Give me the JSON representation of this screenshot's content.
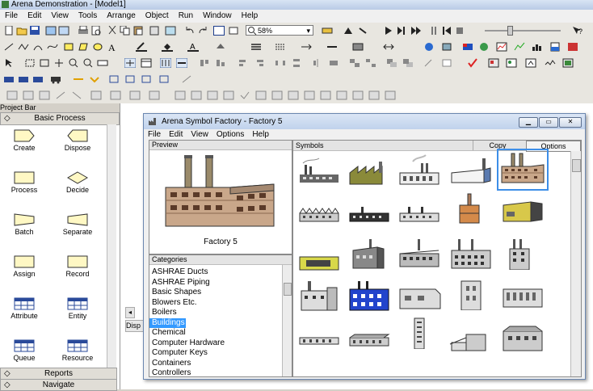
{
  "window": {
    "title": "Arena Demonstration - [Model1]"
  },
  "menubar": [
    "File",
    "Edit",
    "View",
    "Tools",
    "Arrange",
    "Object",
    "Run",
    "Window",
    "Help"
  ],
  "toolbar": {
    "zoom_value": "58%"
  },
  "project_bar": {
    "title": "Project Bar",
    "panel": "Basic Process",
    "modules": [
      {
        "label": "Create",
        "shape": "create"
      },
      {
        "label": "Dispose",
        "shape": "dispose"
      },
      {
        "label": "Process",
        "shape": "rect"
      },
      {
        "label": "Decide",
        "shape": "diamond"
      },
      {
        "label": "Batch",
        "shape": "batch"
      },
      {
        "label": "Separate",
        "shape": "separate"
      },
      {
        "label": "Assign",
        "shape": "rect"
      },
      {
        "label": "Record",
        "shape": "rect"
      },
      {
        "label": "Attribute",
        "shape": "table"
      },
      {
        "label": "Entity",
        "shape": "table"
      },
      {
        "label": "Queue",
        "shape": "table"
      },
      {
        "label": "Resource",
        "shape": "table"
      }
    ],
    "footer_panels": [
      "Reports",
      "Navigate"
    ]
  },
  "canvas_tab": "Disp",
  "dialog": {
    "title": "Arena Symbol Factory - Factory 5",
    "menu": [
      "File",
      "Edit",
      "View",
      "Options",
      "Help"
    ],
    "preview_label": "Preview",
    "preview_caption": "Factory 5",
    "categories_label": "Categories",
    "categories": [
      "ASHRAE Ducts",
      "ASHRAE Piping",
      "Basic Shapes",
      "Blowers Etc.",
      "Boilers",
      "Buildings",
      "Chemical",
      "Computer Hardware",
      "Computer Keys",
      "Containers",
      "Controllers"
    ],
    "selected_category": "Buildings",
    "symbols_label": "Symbols",
    "copy_label": "Copy",
    "options_label": "Options"
  }
}
